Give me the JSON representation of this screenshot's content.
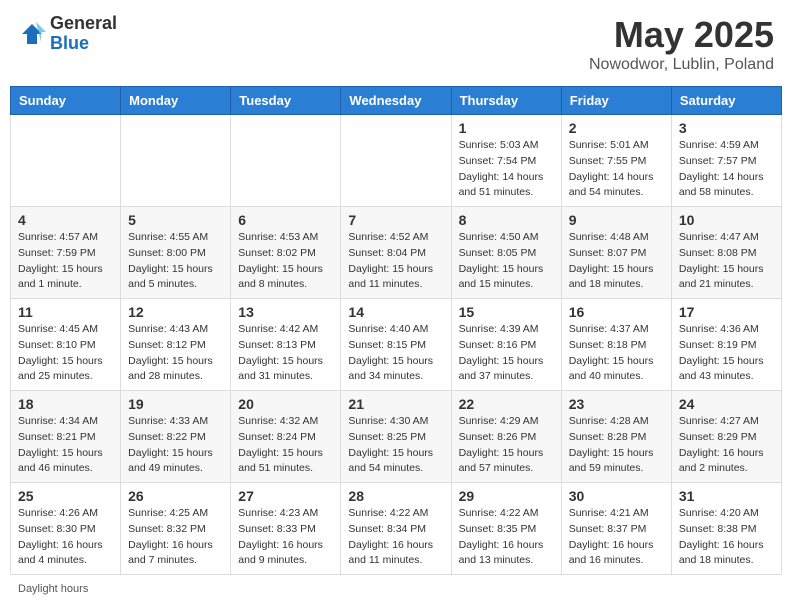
{
  "header": {
    "logo_general": "General",
    "logo_blue": "Blue",
    "month_title": "May 2025",
    "location": "Nowodwor, Lublin, Poland"
  },
  "days_of_week": [
    "Sunday",
    "Monday",
    "Tuesday",
    "Wednesday",
    "Thursday",
    "Friday",
    "Saturday"
  ],
  "footer": {
    "daylight_hours": "Daylight hours"
  },
  "weeks": [
    {
      "days": [
        {
          "num": "",
          "info": ""
        },
        {
          "num": "",
          "info": ""
        },
        {
          "num": "",
          "info": ""
        },
        {
          "num": "",
          "info": ""
        },
        {
          "num": "1",
          "info": "Sunrise: 5:03 AM\nSunset: 7:54 PM\nDaylight: 14 hours\nand 51 minutes."
        },
        {
          "num": "2",
          "info": "Sunrise: 5:01 AM\nSunset: 7:55 PM\nDaylight: 14 hours\nand 54 minutes."
        },
        {
          "num": "3",
          "info": "Sunrise: 4:59 AM\nSunset: 7:57 PM\nDaylight: 14 hours\nand 58 minutes."
        }
      ]
    },
    {
      "days": [
        {
          "num": "4",
          "info": "Sunrise: 4:57 AM\nSunset: 7:59 PM\nDaylight: 15 hours\nand 1 minute."
        },
        {
          "num": "5",
          "info": "Sunrise: 4:55 AM\nSunset: 8:00 PM\nDaylight: 15 hours\nand 5 minutes."
        },
        {
          "num": "6",
          "info": "Sunrise: 4:53 AM\nSunset: 8:02 PM\nDaylight: 15 hours\nand 8 minutes."
        },
        {
          "num": "7",
          "info": "Sunrise: 4:52 AM\nSunset: 8:04 PM\nDaylight: 15 hours\nand 11 minutes."
        },
        {
          "num": "8",
          "info": "Sunrise: 4:50 AM\nSunset: 8:05 PM\nDaylight: 15 hours\nand 15 minutes."
        },
        {
          "num": "9",
          "info": "Sunrise: 4:48 AM\nSunset: 8:07 PM\nDaylight: 15 hours\nand 18 minutes."
        },
        {
          "num": "10",
          "info": "Sunrise: 4:47 AM\nSunset: 8:08 PM\nDaylight: 15 hours\nand 21 minutes."
        }
      ]
    },
    {
      "days": [
        {
          "num": "11",
          "info": "Sunrise: 4:45 AM\nSunset: 8:10 PM\nDaylight: 15 hours\nand 25 minutes."
        },
        {
          "num": "12",
          "info": "Sunrise: 4:43 AM\nSunset: 8:12 PM\nDaylight: 15 hours\nand 28 minutes."
        },
        {
          "num": "13",
          "info": "Sunrise: 4:42 AM\nSunset: 8:13 PM\nDaylight: 15 hours\nand 31 minutes."
        },
        {
          "num": "14",
          "info": "Sunrise: 4:40 AM\nSunset: 8:15 PM\nDaylight: 15 hours\nand 34 minutes."
        },
        {
          "num": "15",
          "info": "Sunrise: 4:39 AM\nSunset: 8:16 PM\nDaylight: 15 hours\nand 37 minutes."
        },
        {
          "num": "16",
          "info": "Sunrise: 4:37 AM\nSunset: 8:18 PM\nDaylight: 15 hours\nand 40 minutes."
        },
        {
          "num": "17",
          "info": "Sunrise: 4:36 AM\nSunset: 8:19 PM\nDaylight: 15 hours\nand 43 minutes."
        }
      ]
    },
    {
      "days": [
        {
          "num": "18",
          "info": "Sunrise: 4:34 AM\nSunset: 8:21 PM\nDaylight: 15 hours\nand 46 minutes."
        },
        {
          "num": "19",
          "info": "Sunrise: 4:33 AM\nSunset: 8:22 PM\nDaylight: 15 hours\nand 49 minutes."
        },
        {
          "num": "20",
          "info": "Sunrise: 4:32 AM\nSunset: 8:24 PM\nDaylight: 15 hours\nand 51 minutes."
        },
        {
          "num": "21",
          "info": "Sunrise: 4:30 AM\nSunset: 8:25 PM\nDaylight: 15 hours\nand 54 minutes."
        },
        {
          "num": "22",
          "info": "Sunrise: 4:29 AM\nSunset: 8:26 PM\nDaylight: 15 hours\nand 57 minutes."
        },
        {
          "num": "23",
          "info": "Sunrise: 4:28 AM\nSunset: 8:28 PM\nDaylight: 15 hours\nand 59 minutes."
        },
        {
          "num": "24",
          "info": "Sunrise: 4:27 AM\nSunset: 8:29 PM\nDaylight: 16 hours\nand 2 minutes."
        }
      ]
    },
    {
      "days": [
        {
          "num": "25",
          "info": "Sunrise: 4:26 AM\nSunset: 8:30 PM\nDaylight: 16 hours\nand 4 minutes."
        },
        {
          "num": "26",
          "info": "Sunrise: 4:25 AM\nSunset: 8:32 PM\nDaylight: 16 hours\nand 7 minutes."
        },
        {
          "num": "27",
          "info": "Sunrise: 4:23 AM\nSunset: 8:33 PM\nDaylight: 16 hours\nand 9 minutes."
        },
        {
          "num": "28",
          "info": "Sunrise: 4:22 AM\nSunset: 8:34 PM\nDaylight: 16 hours\nand 11 minutes."
        },
        {
          "num": "29",
          "info": "Sunrise: 4:22 AM\nSunset: 8:35 PM\nDaylight: 16 hours\nand 13 minutes."
        },
        {
          "num": "30",
          "info": "Sunrise: 4:21 AM\nSunset: 8:37 PM\nDaylight: 16 hours\nand 16 minutes."
        },
        {
          "num": "31",
          "info": "Sunrise: 4:20 AM\nSunset: 8:38 PM\nDaylight: 16 hours\nand 18 minutes."
        }
      ]
    }
  ]
}
